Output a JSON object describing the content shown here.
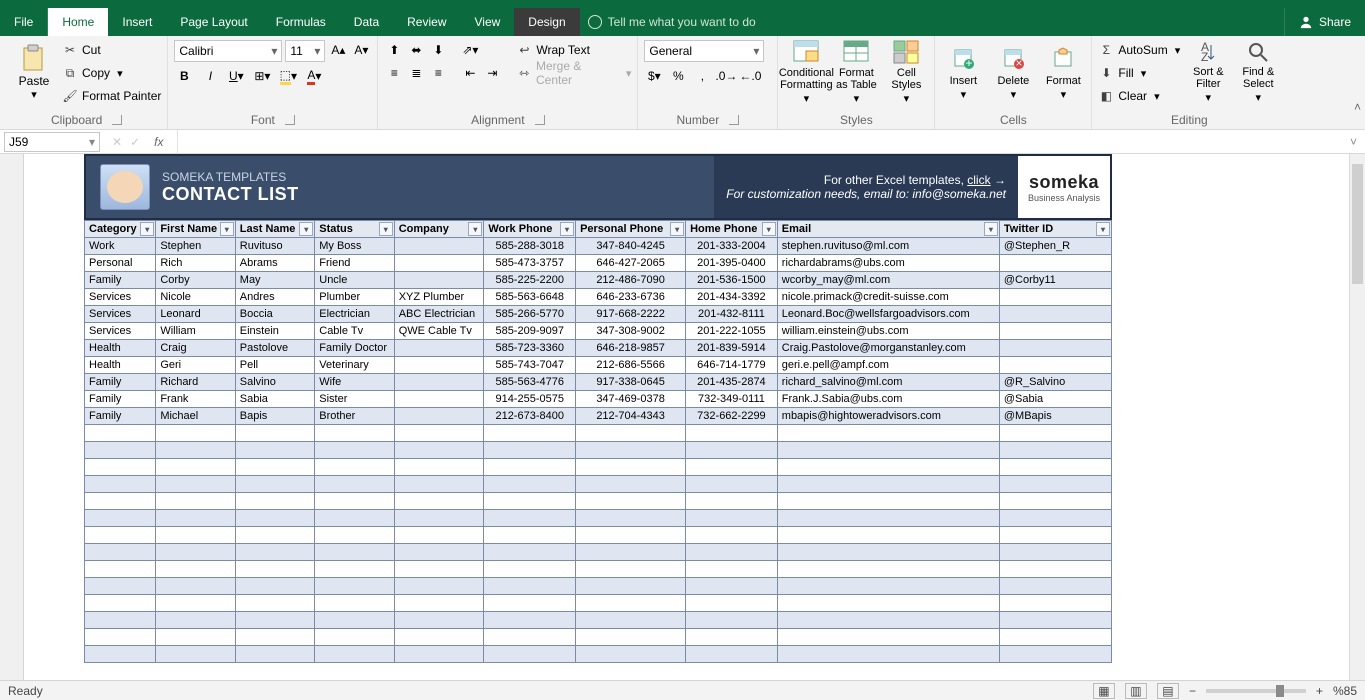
{
  "tabs": {
    "file": "File",
    "home": "Home",
    "insert": "Insert",
    "page": "Page Layout",
    "formulas": "Formulas",
    "data": "Data",
    "review": "Review",
    "view": "View",
    "design": "Design"
  },
  "tellme": "Tell me what you want to do",
  "share": "Share",
  "ribbon": {
    "clipboard": {
      "paste": "Paste",
      "cut": "Cut",
      "copy": "Copy",
      "fmt": "Format Painter",
      "label": "Clipboard"
    },
    "font": {
      "name": "Calibri",
      "size": "11",
      "label": "Font"
    },
    "alignment": {
      "wrap": "Wrap Text",
      "merge": "Merge & Center",
      "label": "Alignment"
    },
    "number": {
      "format": "General",
      "label": "Number"
    },
    "styles": {
      "cond": "Conditional Formatting",
      "fat": "Format as Table",
      "cell": "Cell Styles",
      "label": "Styles"
    },
    "cells": {
      "insert": "Insert",
      "delete": "Delete",
      "format": "Format",
      "label": "Cells"
    },
    "editing": {
      "sum": "AutoSum",
      "fill": "Fill",
      "clear": "Clear",
      "sort": "Sort & Filter",
      "find": "Find & Select",
      "label": "Editing"
    }
  },
  "namebox": "J59",
  "banner": {
    "sub": "SOMEKA TEMPLATES",
    "title": "CONTACT LIST",
    "r1a": "For other Excel templates, ",
    "r1b": "click",
    "r2a": "For customization needs, email to: ",
    "r2b": "info@someka.net",
    "logo": "someka",
    "logosub": "Business Analysis"
  },
  "cols": [
    "Category",
    "First Name",
    "Last Name",
    "Status",
    "Company",
    "Work Phone",
    "Personal Phone",
    "Home Phone",
    "Email",
    "Twitter ID"
  ],
  "widths": [
    70,
    78,
    78,
    78,
    88,
    90,
    108,
    90,
    218,
    110
  ],
  "rows": [
    [
      "Work",
      "Stephen",
      "Ruvituso",
      "My Boss",
      "",
      "585-288-3018",
      "347-840-4245",
      "201-333-2004",
      "stephen.ruvituso@ml.com",
      "@Stephen_R"
    ],
    [
      "Personal",
      "Rich",
      "Abrams",
      "Friend",
      "",
      "585-473-3757",
      "646-427-2065",
      "201-395-0400",
      "richardabrams@ubs.com",
      ""
    ],
    [
      "Family",
      "Corby",
      "May",
      "Uncle",
      "",
      "585-225-2200",
      "212-486-7090",
      "201-536-1500",
      "wcorby_may@ml.com",
      "@Corby11"
    ],
    [
      "Services",
      "Nicole",
      "Andres",
      "Plumber",
      "XYZ Plumber",
      "585-563-6648",
      "646-233-6736",
      "201-434-3392",
      "nicole.primack@credit-suisse.com",
      ""
    ],
    [
      "Services",
      "Leonard",
      "Boccia",
      "Electrician",
      "ABC Electrician",
      "585-266-5770",
      "917-668-2222",
      "201-432-8111",
      "Leonard.Boc@wellsfargoadvisors.com",
      ""
    ],
    [
      "Services",
      "William",
      "Einstein",
      "Cable Tv",
      "QWE Cable Tv",
      "585-209-9097",
      "347-308-9002",
      "201-222-1055",
      "william.einstein@ubs.com",
      ""
    ],
    [
      "Health",
      "Craig",
      "Pastolove",
      "Family Doctor",
      "",
      "585-723-3360",
      "646-218-9857",
      "201-839-5914",
      "Craig.Pastolove@morganstanley.com",
      ""
    ],
    [
      "Health",
      "Geri",
      "Pell",
      "Veterinary",
      "",
      "585-743-7047",
      "212-686-5566",
      "646-714-1779",
      "geri.e.pell@ampf.com",
      ""
    ],
    [
      "Family",
      "Richard",
      "Salvino",
      "Wife",
      "",
      "585-563-4776",
      "917-338-0645",
      "201-435-2874",
      "richard_salvino@ml.com",
      "@R_Salvino"
    ],
    [
      "Family",
      "Frank",
      "Sabia",
      "Sister",
      "",
      "914-255-0575",
      "347-469-0378",
      "732-349-0111",
      "Frank.J.Sabia@ubs.com",
      "@Sabia"
    ],
    [
      "Family",
      "Michael",
      "Bapis",
      "Brother",
      "",
      "212-673-8400",
      "212-704-4343",
      "732-662-2299",
      "mbapis@hightoweradvisors.com",
      "@MBapis"
    ]
  ],
  "blank_rows": 14,
  "status": {
    "ready": "Ready",
    "zoom": "%85"
  }
}
